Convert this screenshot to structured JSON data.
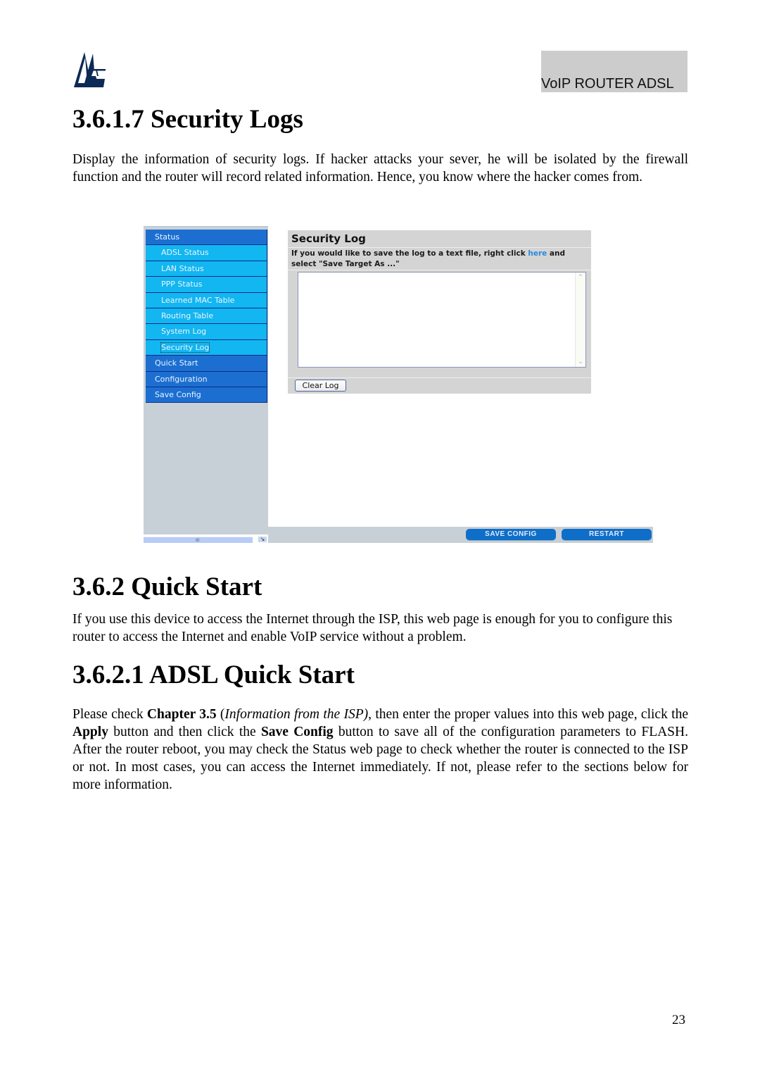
{
  "header": {
    "logo": "atlantis-logo-icon",
    "product_label": "VoIP ROUTER ADSL"
  },
  "sections": {
    "security_logs": {
      "title": "3.6.1.7 Security Logs",
      "body": "Display the information of security logs. If hacker attacks your sever, he will be isolated by the firewall function and the router will record related information. Hence, you know where the hacker comes from."
    },
    "quick_start": {
      "title": "3.6.2 Quick Start",
      "body": "If you use this device to access the Internet through the ISP, this web page is enough for you to configure this router to access the Internet and enable VoIP service without a problem."
    },
    "adsl_quick_start": {
      "title": "3.6.2.1 ADSL Quick Start",
      "body_parts": {
        "t1": "Please check ",
        "b1": "Chapter 3.5",
        "t2": " (",
        "i1": "Information from the ISP)",
        "t3": ", then enter the proper values into this web page, click the ",
        "b2": "Apply",
        "t4": " button and then click the ",
        "b3": "Save Config",
        "t5": " button to save all of the configuration parameters to FLASH. After the router reboot, you may check the Status web page to check whether the router is connected to the ISP or not. In most cases, you can access the Internet immediately.  If not, please refer to the sections below for more information."
      }
    }
  },
  "screenshot": {
    "sidebar": {
      "items": [
        {
          "label": "Status",
          "level": "top"
        },
        {
          "label": "ADSL Status",
          "level": "sub"
        },
        {
          "label": "LAN Status",
          "level": "sub"
        },
        {
          "label": "PPP Status",
          "level": "sub"
        },
        {
          "label": "Learned MAC Table",
          "level": "sub"
        },
        {
          "label": "Routing Table",
          "level": "sub"
        },
        {
          "label": "System Log",
          "level": "sub"
        },
        {
          "label": "Security Log",
          "level": "sub",
          "selected": true
        },
        {
          "label": "Quick Start",
          "level": "top"
        },
        {
          "label": "Configuration",
          "level": "top"
        },
        {
          "label": "Save Config",
          "level": "top"
        }
      ],
      "scroll_grip": "III",
      "scroll_arrow": "↘"
    },
    "panel": {
      "title": "Security Log",
      "desc_before": "If you would like to save the log to a text file, right click ",
      "desc_link": "here",
      "desc_after": " and select \"Save Target As ...\"",
      "log_value": "",
      "clear_button": "Clear Log"
    },
    "footer_buttons": {
      "save_config": "SAVE CONFIG",
      "restart": "RESTART"
    },
    "colors": {
      "nav_top": "#1c6fd1",
      "nav_sub": "#12b6f0",
      "button_blue": "#0e6ec8",
      "link": "#2a8ae0"
    }
  },
  "page_number": "23"
}
